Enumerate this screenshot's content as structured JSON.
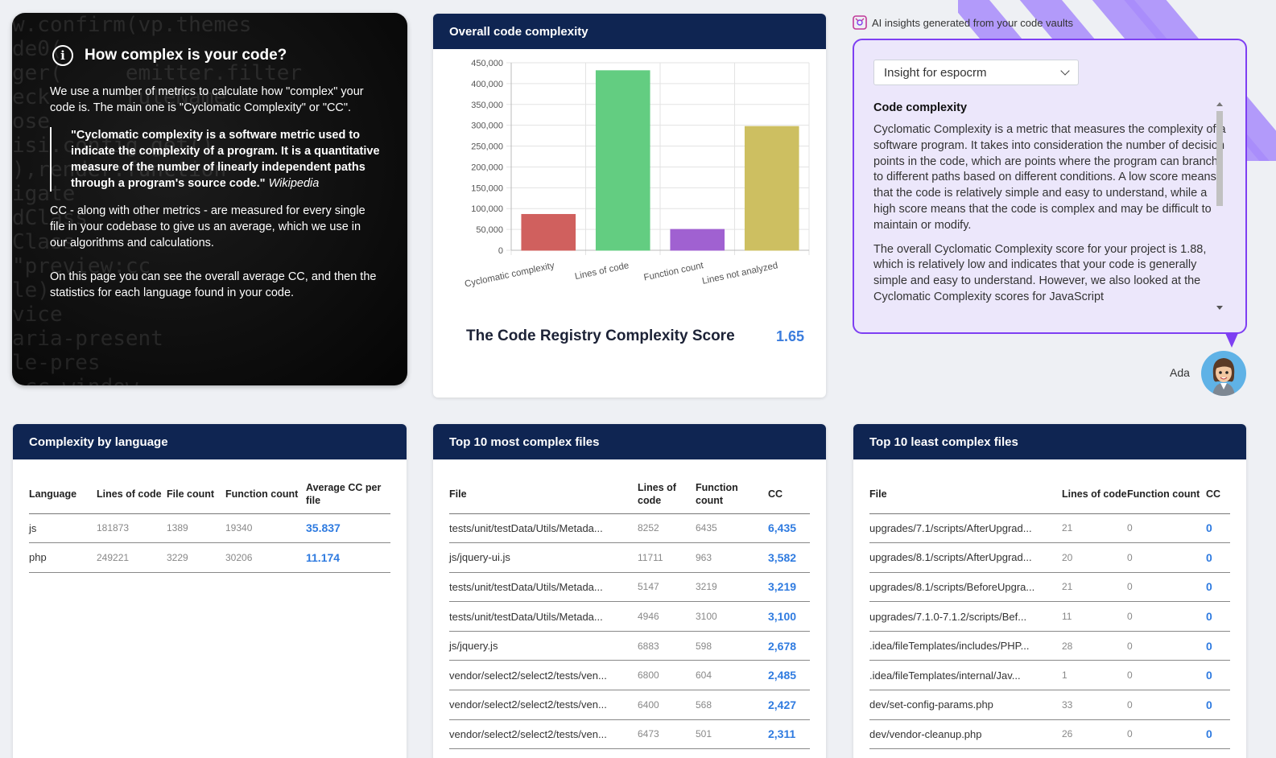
{
  "intro": {
    "title": "How complex is your code?",
    "icon": "info-icon",
    "p1": "We use a number of metrics to calculate how \"complex\" your code is. The main one is \"Cyclomatic Complexity\" or \"CC\".",
    "quote": "\"Cyclomatic complexity is a software metric used to indicate the complexity of a program. It is a quantitative measure of the number of linearly independent paths through a program's source code.\"",
    "quote_source": "Wikipedia",
    "p2": "CC - along with other metrics - are measured for every single file in your codebase to give us an average, which we use in our algorithms and calculations.",
    "p3": "On this page you can see the overall average CC, and then the statistics for each language found in your code.",
    "background_code": "w.confirm(vp.themes\nde0(\nger(     emitter.filter\neck      ruleName\nose\nisi.config.get()\n),render:function\nigate\ndClass\nClass\n\"preview:cc\nle)\nvice\naria-present\nle-pres\n.cc.window.\n+Theme()."
  },
  "overall": {
    "header": "Overall code complexity",
    "score_label": "The Code Registry Complexity Score",
    "score_value": "1.65"
  },
  "chart_data": {
    "type": "bar",
    "categories": [
      "Cyclomatic complexity",
      "Lines of code",
      "Function count",
      "Lines not analyzed"
    ],
    "values": [
      86000,
      431000,
      50000,
      297000
    ],
    "colors": [
      "#d0605e",
      "#63cd81",
      "#a061d1",
      "#cdbf61"
    ],
    "ylim": [
      0,
      450000
    ],
    "yticks": [
      "0",
      "50,000",
      "100,000",
      "150,000",
      "200,000",
      "250,000",
      "300,000",
      "350,000",
      "400,000",
      "450,000"
    ],
    "grid": true,
    "title": "",
    "xlabel": "",
    "ylabel": ""
  },
  "ai": {
    "top_label": "AI insights generated from your code vaults",
    "select_value": "Insight for espocrm",
    "heading": "Code complexity",
    "p1": "Cyclomatic Complexity is a metric that measures the complexity of a software program. It takes into consideration the number of decision points in the code, which are points where the program can branch to different paths based on different conditions. A low score means that the code is relatively simple and easy to understand, while a high score means that the code is complex and may be difficult to maintain or modify.",
    "p2": "The overall Cyclomatic Complexity score for your project is 1.88, which is relatively low and indicates that your code is generally simple and easy to understand. However, we also looked at the Cyclomatic Complexity scores for JavaScript",
    "assistant_name": "Ada",
    "accent": "#7e3ff2"
  },
  "lang_table": {
    "header": "Complexity by language",
    "columns": [
      "Language",
      "Lines of code",
      "File count",
      "Function count",
      "Average CC per file"
    ],
    "rows": [
      [
        "js",
        "181873",
        "1389",
        "19340",
        "35.837"
      ],
      [
        "php",
        "249221",
        "3229",
        "30206",
        "11.174"
      ]
    ]
  },
  "most_table": {
    "header": "Top 10 most complex files",
    "columns": [
      "File",
      "Lines of code",
      "Function count",
      "CC"
    ],
    "rows": [
      [
        "tests/unit/testData/Utils/Metada...",
        "8252",
        "6435",
        "6,435"
      ],
      [
        "js/jquery-ui.js",
        "11711",
        "963",
        "3,582"
      ],
      [
        "tests/unit/testData/Utils/Metada...",
        "5147",
        "3219",
        "3,219"
      ],
      [
        "tests/unit/testData/Utils/Metada...",
        "4946",
        "3100",
        "3,100"
      ],
      [
        "js/jquery.js",
        "6883",
        "598",
        "2,678"
      ],
      [
        "vendor/select2/select2/tests/ven...",
        "6800",
        "604",
        "2,485"
      ],
      [
        "vendor/select2/select2/tests/ven...",
        "6400",
        "568",
        "2,427"
      ],
      [
        "vendor/select2/select2/tests/ven...",
        "6473",
        "501",
        "2,311"
      ]
    ]
  },
  "least_table": {
    "header": "Top 10 least complex files",
    "columns": [
      "File",
      "Lines of code",
      "Function count",
      "CC"
    ],
    "rows": [
      [
        "upgrades/7.1/scripts/AfterUpgrad...",
        "21",
        "0",
        "0"
      ],
      [
        "upgrades/8.1/scripts/AfterUpgrad...",
        "20",
        "0",
        "0"
      ],
      [
        "upgrades/8.1/scripts/BeforeUpgra...",
        "21",
        "0",
        "0"
      ],
      [
        "upgrades/7.1.0-7.1.2/scripts/Bef...",
        "11",
        "0",
        "0"
      ],
      [
        ".idea/fileTemplates/includes/PHP...",
        "28",
        "0",
        "0"
      ],
      [
        ".idea/fileTemplates/internal/Jav...",
        "1",
        "0",
        "0"
      ],
      [
        "dev/set-config-params.php",
        "33",
        "0",
        "0"
      ],
      [
        "dev/vendor-cleanup.php",
        "26",
        "0",
        "0"
      ]
    ]
  }
}
